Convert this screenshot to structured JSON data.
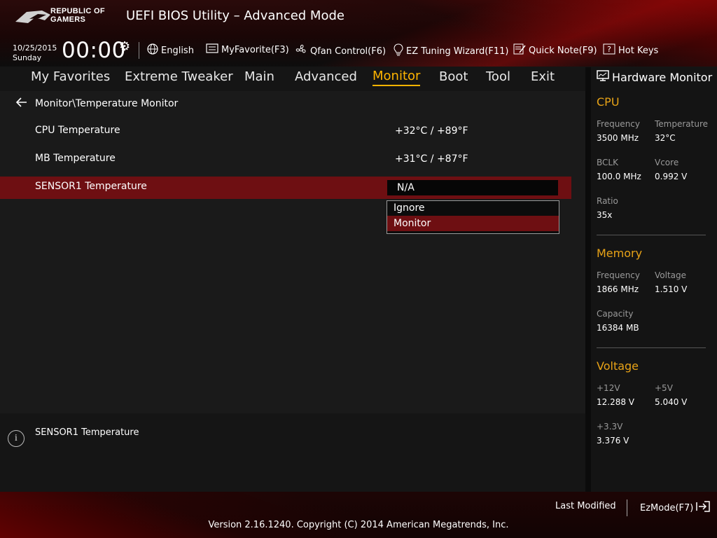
{
  "brand": {
    "line1": "REPUBLIC OF",
    "line2": "GAMERS"
  },
  "app_title": "UEFI BIOS Utility – Advanced Mode",
  "datetime": {
    "date": "10/25/2015",
    "day": "Sunday",
    "time": "00:00"
  },
  "toolbar": {
    "language": "English",
    "myfavorite": "MyFavorite(F3)",
    "qfan": "Qfan Control(F6)",
    "ez_tuning": "EZ Tuning Wizard(F11)",
    "quick_note": "Quick Note(F9)",
    "hot_keys": "Hot Keys"
  },
  "nav": {
    "tabs": [
      {
        "label": "My Favorites"
      },
      {
        "label": "Extreme Tweaker"
      },
      {
        "label": "Main"
      },
      {
        "label": "Advanced"
      },
      {
        "label": "Monitor"
      },
      {
        "label": "Boot"
      },
      {
        "label": "Tool"
      },
      {
        "label": "Exit"
      }
    ],
    "active": "Monitor"
  },
  "breadcrumb": "Monitor\\Temperature Monitor",
  "settings": [
    {
      "label": "CPU Temperature",
      "value": "+32°C / +89°F"
    },
    {
      "label": "MB Temperature",
      "value": "+31°C / +87°F"
    },
    {
      "label": "SENSOR1 Temperature",
      "value": "N/A"
    }
  ],
  "dropdown": {
    "options": [
      "Ignore",
      "Monitor"
    ],
    "selected": "Monitor"
  },
  "help_text": "SENSOR1 Temperature",
  "hw_monitor": {
    "title": "Hardware Monitor",
    "cpu": {
      "title": "CPU",
      "frequency_label": "Frequency",
      "frequency": "3500 MHz",
      "temperature_label": "Temperature",
      "temperature": "32°C",
      "bclk_label": "BCLK",
      "bclk": "100.0 MHz",
      "vcore_label": "Vcore",
      "vcore": "0.992 V",
      "ratio_label": "Ratio",
      "ratio": "35x"
    },
    "memory": {
      "title": "Memory",
      "frequency_label": "Frequency",
      "frequency": "1866 MHz",
      "voltage_label": "Voltage",
      "voltage": "1.510 V",
      "capacity_label": "Capacity",
      "capacity": "16384 MB"
    },
    "voltage": {
      "title": "Voltage",
      "v12_label": "+12V",
      "v12": "12.288 V",
      "v5_label": "+5V",
      "v5": "5.040 V",
      "v33_label": "+3.3V",
      "v33": "3.376 V"
    }
  },
  "footer": {
    "last_modified": "Last Modified",
    "ezmode": "EzMode(F7)",
    "version": "Version 2.16.1240. Copyright (C) 2014 American Megatrends, Inc."
  },
  "colors": {
    "accent": "#ffb400",
    "section_title": "#e8a317",
    "highlight": "#6e0f12"
  }
}
